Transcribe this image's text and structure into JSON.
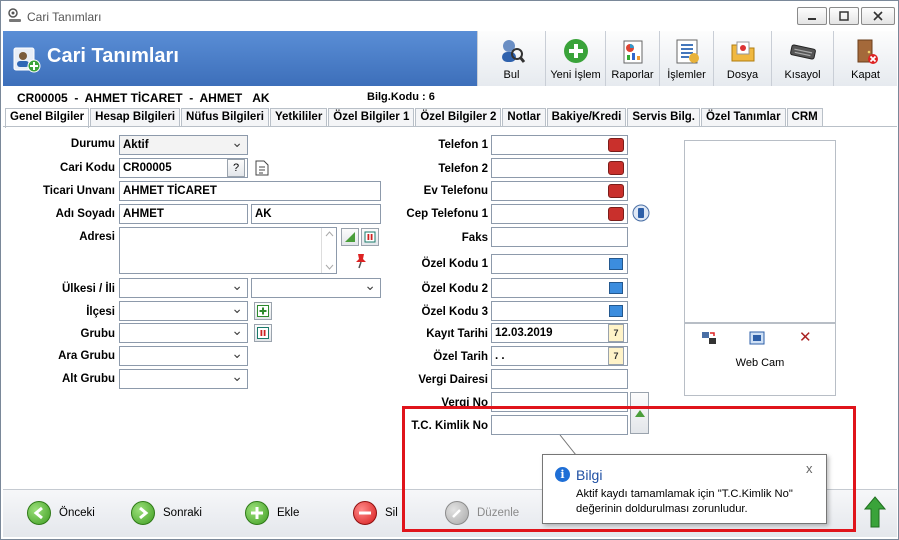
{
  "window": {
    "title": "Cari Tanımları",
    "controls": {
      "minimize": "▭",
      "maximize": "▢",
      "close": "✕"
    }
  },
  "header": {
    "title": "Cari Tanımları",
    "toolbar": [
      {
        "label": "Bul",
        "icon": "search-person-icon"
      },
      {
        "label": "Yeni İşlem",
        "icon": "add-circle-icon"
      },
      {
        "label": "Raporlar",
        "icon": "report-icon"
      },
      {
        "label": "İşlemler",
        "icon": "operations-icon"
      },
      {
        "label": "Dosya",
        "icon": "folder-icon"
      },
      {
        "label": "Kısayol",
        "icon": "keyboard-icon"
      },
      {
        "label": "Kapat",
        "icon": "exit-door-icon"
      }
    ]
  },
  "record": {
    "code": "CR00005",
    "sep": "-",
    "title": "AHMET TİCARET",
    "name": "AHMET",
    "surname": "AK",
    "bilg_kodu": "Bilg.Kodu : 6"
  },
  "tabs": [
    "Genel Bilgiler",
    "Hesap Bilgileri",
    "Nüfus Bilgileri",
    "Yetkililer",
    "Özel Bilgiler 1",
    "Özel Bilgiler 2",
    "Notlar",
    "Bakiye/Kredi",
    "Servis Bilg.",
    "Özel Tanımlar",
    "CRM"
  ],
  "form_left": {
    "durumu_label": "Durumu",
    "durumu_value": "Aktif",
    "cari_kodu_label": "Cari Kodu",
    "cari_kodu_value": "CR00005",
    "cari_kodu_btn": "?",
    "ticari_unvani_label": "Ticari Unvanı",
    "ticari_unvani_value": "AHMET TİCARET",
    "adi_soyadi_label": "Adı Soyadı",
    "adi_value": "AHMET",
    "soyadi_value": "AK",
    "adresi_label": "Adresi",
    "adresi_value": "",
    "ulke_il_label": "Ülkesi / İli",
    "ilce_label": "İlçesi",
    "grubu_label": "Grubu",
    "ara_grubu_label": "Ara Grubu",
    "alt_grubu_label": "Alt Grubu"
  },
  "form_right": {
    "telefon1_label": "Telefon 1",
    "telefon2_label": "Telefon 2",
    "ev_telefonu_label": "Ev Telefonu",
    "cep_telefonu_label": "Cep Telefonu 1",
    "faks_label": "Faks",
    "ozel_kodu1_label": "Özel Kodu 1",
    "ozel_kodu2_label": "Özel Kodu 2",
    "ozel_kodu3_label": "Özel Kodu 3",
    "kayit_tarihi_label": "Kayıt Tarihi",
    "kayit_tarihi_value": "12.03.2019",
    "ozel_tarih_label": "Özel Tarih",
    "ozel_tarih_value": " . .",
    "vergi_dairesi_label": "Vergi Dairesi",
    "vergi_no_label": "Vergi No",
    "tc_kimlik_label": "T.C. Kimlik No",
    "calendar_glyph": "7"
  },
  "webcam": {
    "label": "Web Cam",
    "delete_glyph": "✕"
  },
  "bottom": {
    "prev": "Önceki",
    "next": "Sonraki",
    "add": "Ekle",
    "delete": "Sil",
    "edit": "Düzenle"
  },
  "tooltip": {
    "title": "Bilgi",
    "message": "Aktif kaydı tamamlamak için \"T.C.Kimlik No\" değerinin doldurulması zorunludur.",
    "close": "x"
  },
  "colors": {
    "header_blue": "#4a7fcb",
    "alert_red": "#e0141b",
    "tooltip_title": "#1e4fa3"
  }
}
